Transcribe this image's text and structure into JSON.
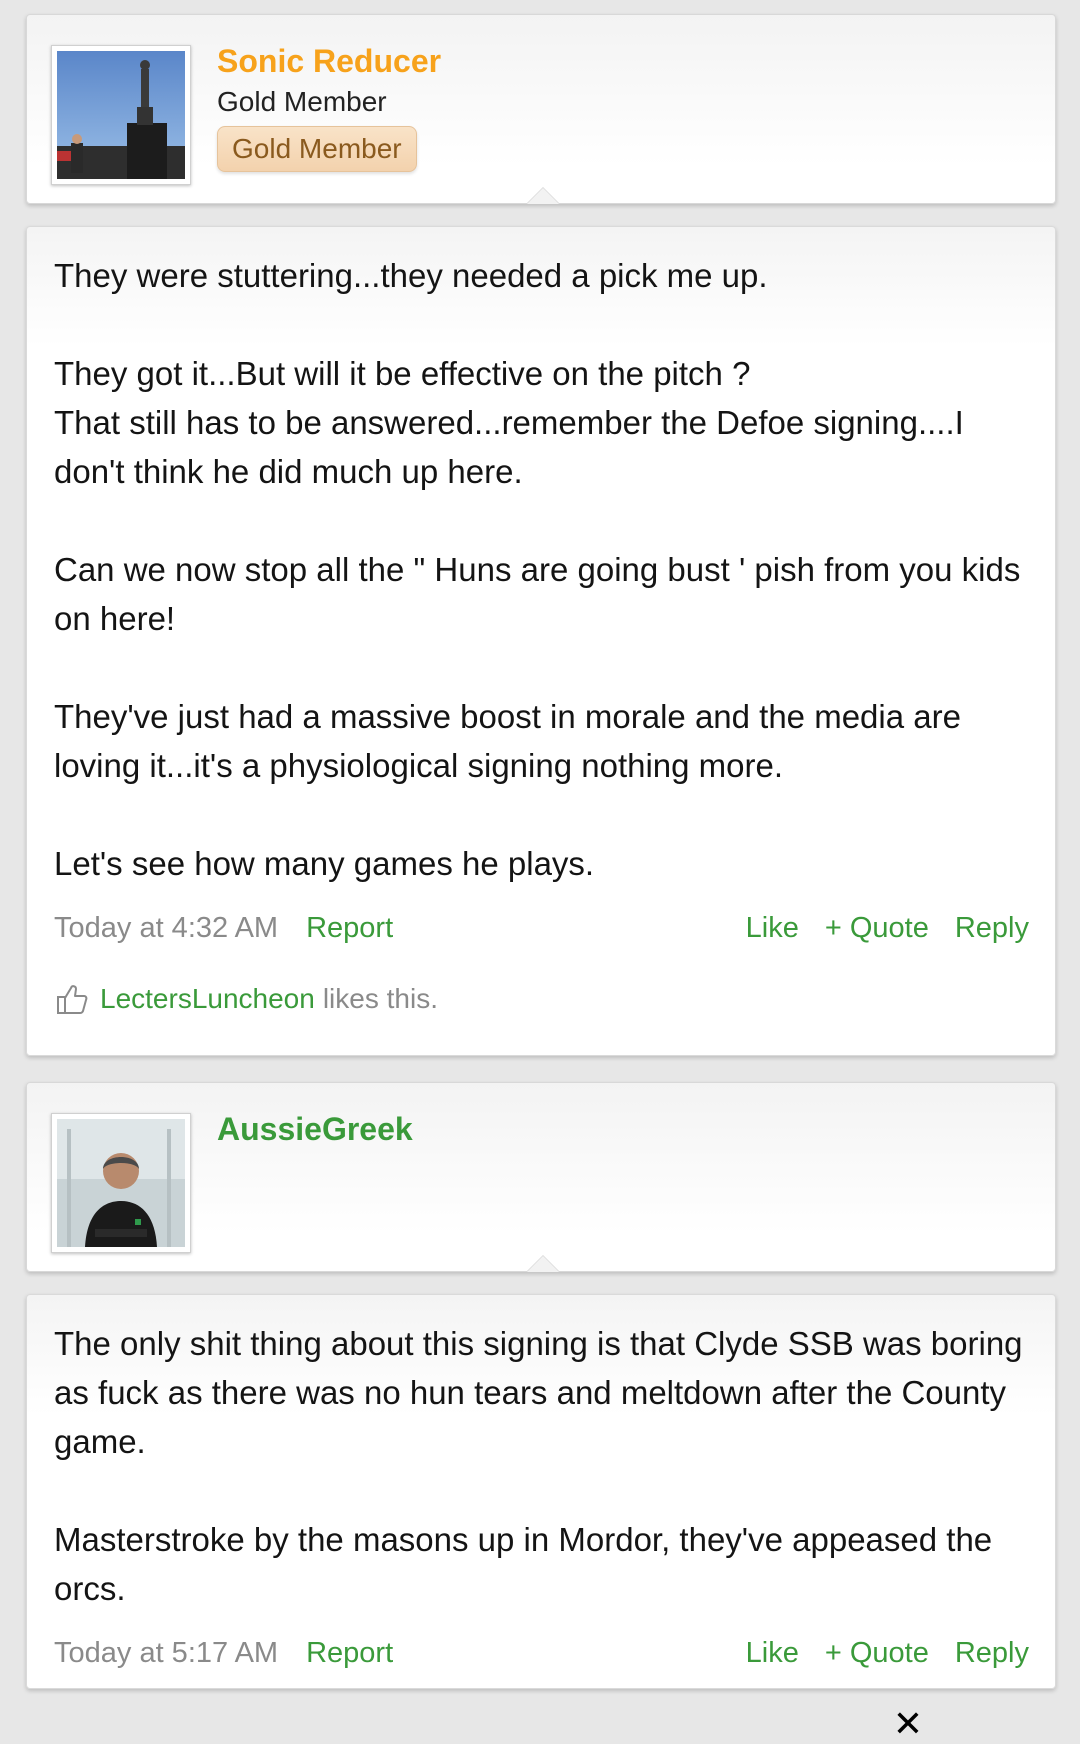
{
  "posts": [
    {
      "user": {
        "username": "Sonic Reducer",
        "username_color": "#f7a21b",
        "title": "Gold Member",
        "badge": "Gold Member"
      },
      "paragraphs": [
        "They were stuttering...they needed a pick me up.",
        "They got it...But will it be effective on the pitch ?",
        "That still has to be answered...remember the Defoe signing....I don't think he did much up here.",
        "Can we now stop all the \" Huns are going bust ' pish from you kids on here!",
        "They've just had a massive boost in morale and the media are loving it...it's a physiological signing nothing more.",
        "Let's see how many games he plays."
      ],
      "timestamp": "Today at 4:32 AM",
      "report_label": "Report",
      "like_label": "Like",
      "quote_label": "+ Quote",
      "reply_label": "Reply",
      "likes": {
        "liker": "LectersLuncheon",
        "suffix": "likes this."
      }
    },
    {
      "user": {
        "username": "AussieGreek",
        "username_color": "#3a9a3a"
      },
      "paragraphs": [
        "The only shit thing about this signing is that Clyde SSB was boring as fuck as there was no hun tears and meltdown after the County game.",
        "Masterstroke by the masons up in Mordor, they've appeased the orcs."
      ],
      "timestamp": "Today at 5:17 AM",
      "report_label": "Report",
      "like_label": "Like",
      "quote_label": "+ Quote",
      "reply_label": "Reply"
    }
  ],
  "close_glyph": "✕",
  "colors": {
    "link": "#3a9a3a",
    "muted": "#8a8a8a",
    "badge_bg": "#f5d8b6",
    "badge_text": "#8a5a1e"
  }
}
